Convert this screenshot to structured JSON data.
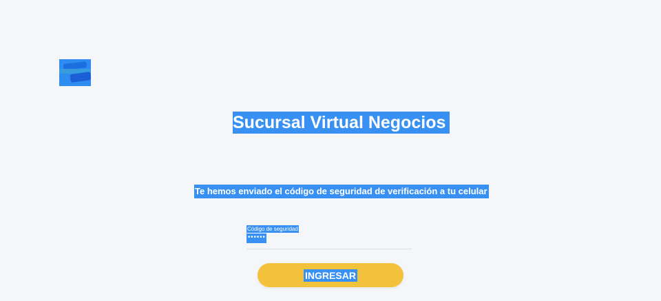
{
  "brand": {
    "logo_icon": "bank-logo-icon",
    "accent_color": "#3790f2",
    "button_color": "#f3c23c"
  },
  "header": {
    "title": "Sucursal Virtual Negocios"
  },
  "main": {
    "message": "Te hemos enviado el código de seguridad de verificación a tu celular",
    "security_code": {
      "label": "Código de seguridad",
      "value": "••••••"
    },
    "submit_label": "INGRESAR"
  }
}
